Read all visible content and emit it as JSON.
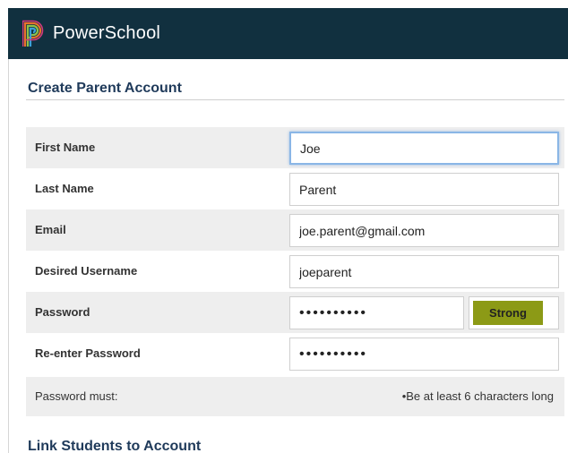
{
  "header": {
    "brand": "PowerSchool",
    "logo_icon": "powerschool-logo-icon",
    "background": "#11303f"
  },
  "section": {
    "title": "Create Parent Account",
    "next_title": "Link Students to Account"
  },
  "form": {
    "first_name": {
      "label": "First Name",
      "value": "Joe"
    },
    "last_name": {
      "label": "Last Name",
      "value": "Parent"
    },
    "email": {
      "label": "Email",
      "value": "joe.parent@gmail.com"
    },
    "username": {
      "label": "Desired Username",
      "value": "joeparent"
    },
    "password": {
      "label": "Password",
      "value": "••••••••••",
      "strength": "Strong",
      "strength_color": "#8c9a16"
    },
    "reenter_password": {
      "label": "Re-enter Password",
      "value": "••••••••••"
    }
  },
  "requirements": {
    "label": "Password must:",
    "rule": "•Be at least 6 characters long"
  }
}
